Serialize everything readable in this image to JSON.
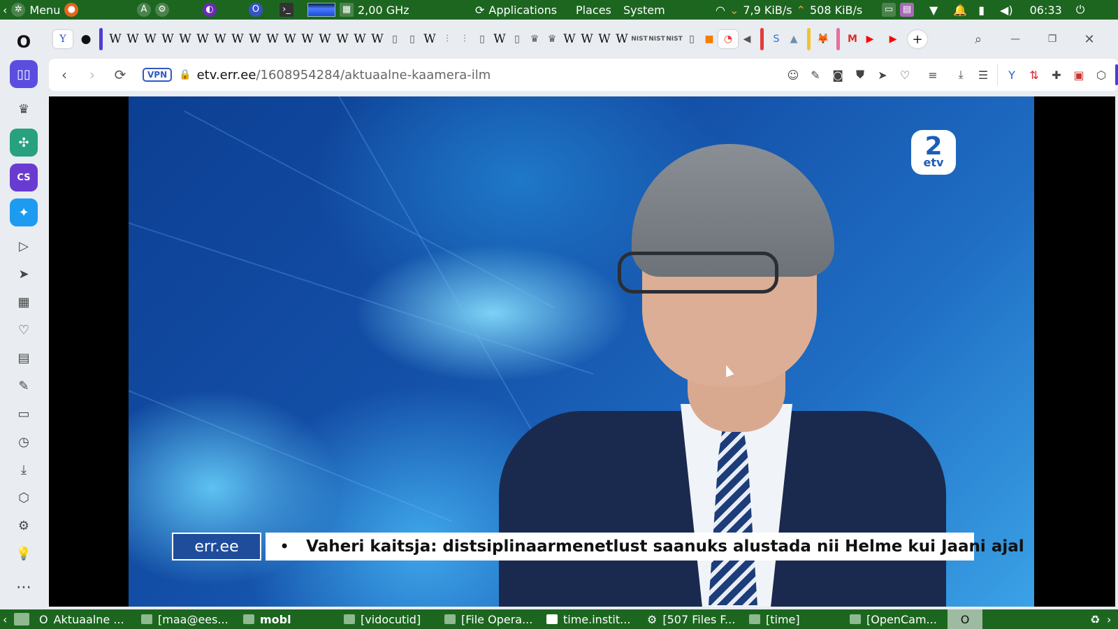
{
  "top_panel": {
    "menu_label": "Menu",
    "cpu_freq": "2,00 GHz",
    "applications_label": "Applications",
    "places_label": "Places",
    "system_label": "System",
    "net_down": "7,9 KiB/s",
    "net_up": "508 KiB/s",
    "clock": "06:33"
  },
  "sidebar": {
    "items": [
      "opera-logo",
      "workspaces",
      "crown",
      "chatgpt",
      "cs",
      "twitter",
      "player",
      "send",
      "apps",
      "heart",
      "news",
      "edit",
      "screen",
      "history",
      "downloads",
      "cube",
      "settings",
      "bulb",
      "more"
    ]
  },
  "tabs": {
    "favicons": [
      "W",
      "W",
      "W",
      "W",
      "W",
      "W",
      "W",
      "W",
      "W",
      "W",
      "W",
      "W",
      "W",
      "W",
      "W",
      "W",
      "W",
      "W"
    ]
  },
  "address_bar": {
    "vpn_label": "VPN",
    "url_domain": "etv.err.ee",
    "url_path": "/1608954284/aktuaalne-kaamera-ilm"
  },
  "video": {
    "channel_logo_number": "2",
    "channel_logo_text": "etv",
    "ticker_source": "err.ee",
    "ticker_bullet": "•",
    "ticker_text": "Vaheri kaitsja: distsiplinaarmenetlust saanuks alustada nii Helme kui Jaani ajal"
  },
  "taskbar": {
    "tasks": [
      {
        "label": "Aktuaalne ..."
      },
      {
        "label": "[maa@ees..."
      },
      {
        "label": "mobl"
      },
      {
        "label": "[vidocutid]"
      },
      {
        "label": "[File Opera..."
      },
      {
        "label": "time.instit..."
      },
      {
        "label": "[507 Files F..."
      },
      {
        "label": "[time]"
      },
      {
        "label": "[OpenCam..."
      }
    ]
  }
}
